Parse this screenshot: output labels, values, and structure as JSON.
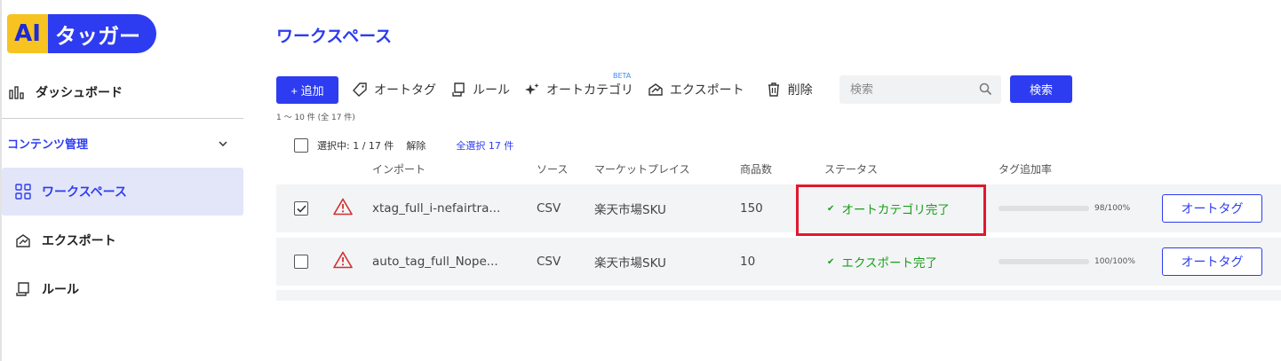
{
  "logo": {
    "ai": "AI",
    "rest": "タッガー"
  },
  "sidebar": {
    "dashboard": "ダッシュボード",
    "section": "コンテンツ管理",
    "items": [
      {
        "label": "ワークスペース",
        "icon": "grid-icon",
        "active": true
      },
      {
        "label": "エクスポート",
        "icon": "export-icon",
        "active": false
      },
      {
        "label": "ルール",
        "icon": "scroll-icon",
        "active": false
      }
    ]
  },
  "page": {
    "title": "ワークスペース"
  },
  "toolbar": {
    "add": "+ 追加",
    "autotag": "オートタグ",
    "rule": "ルール",
    "autocategory": "オートカテゴリ",
    "beta": "BETA",
    "export": "エクスポート",
    "delete": "削除",
    "search_placeholder": "検索",
    "search_button": "検索"
  },
  "range": "1 ～ 10 件 (全 17 件)",
  "selection": {
    "text": "選択中: 1 / 17 件",
    "clear": "解除",
    "select_all": "全選択 17 件"
  },
  "columns": {
    "import": "インポート",
    "source": "ソース",
    "marketplace": "マーケットプレイス",
    "count": "商品数",
    "status": "ステータス",
    "tag_rate": "タグ追加率"
  },
  "rows": [
    {
      "checked": true,
      "name": "xtag_full_i-nefairtra...",
      "source": "CSV",
      "marketplace": "楽天市場SKU",
      "count": "150",
      "status": "オートカテゴリ完了",
      "rate_label": "98/100%",
      "rate": 0.98,
      "action": "オートタグ"
    },
    {
      "checked": false,
      "name": "auto_tag_full_Nope...",
      "source": "CSV",
      "marketplace": "楽天市場SKU",
      "count": "10",
      "status": "エクスポート完了",
      "rate_label": "100/100%",
      "rate": 1.0,
      "action": "オートタグ"
    }
  ],
  "colors": {
    "accent": "#2d3cf0",
    "success": "#1a9e1a",
    "warning": "#d32f2f",
    "highlight": "#e0182d",
    "logo_yellow": "#f6c321"
  }
}
